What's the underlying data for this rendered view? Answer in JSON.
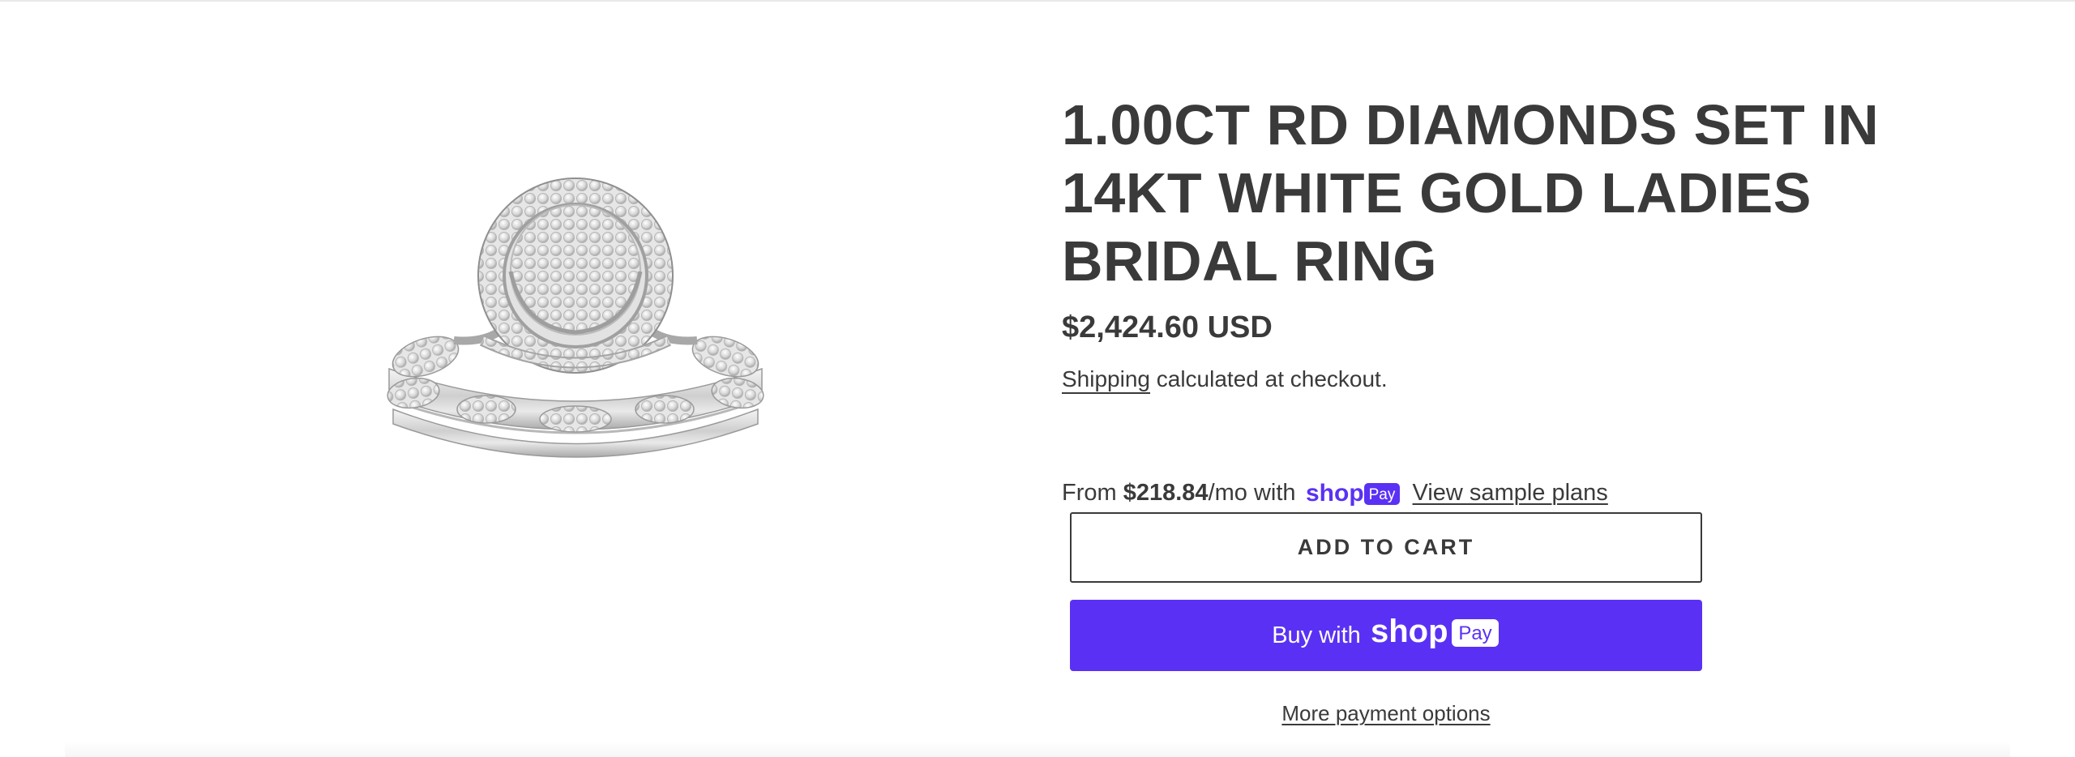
{
  "product": {
    "image_alt": "ring",
    "title": "1.00CT RD DIAMONDS SET IN 14KT WHITE GOLD LADIES BRIDAL RING",
    "price": "$2,424.60 USD",
    "shipping_link": "Shipping",
    "shipping_suffix": " calculated at checkout."
  },
  "installments": {
    "prefix": "From ",
    "amount": "$218.84",
    "suffix": "/mo with",
    "brand_icon": "shop-pay-icon",
    "link": "View sample plans"
  },
  "buttons": {
    "add_to_cart": "ADD TO CART",
    "buy_with": "Buy with",
    "more_payment_options": "More payment options"
  },
  "shop_pay": {
    "wordmark": "shop",
    "badge": "Pay"
  },
  "colors": {
    "text": "#3a3a3a",
    "shop_pay_purple": "#5a31f4",
    "background": "#ffffff"
  }
}
